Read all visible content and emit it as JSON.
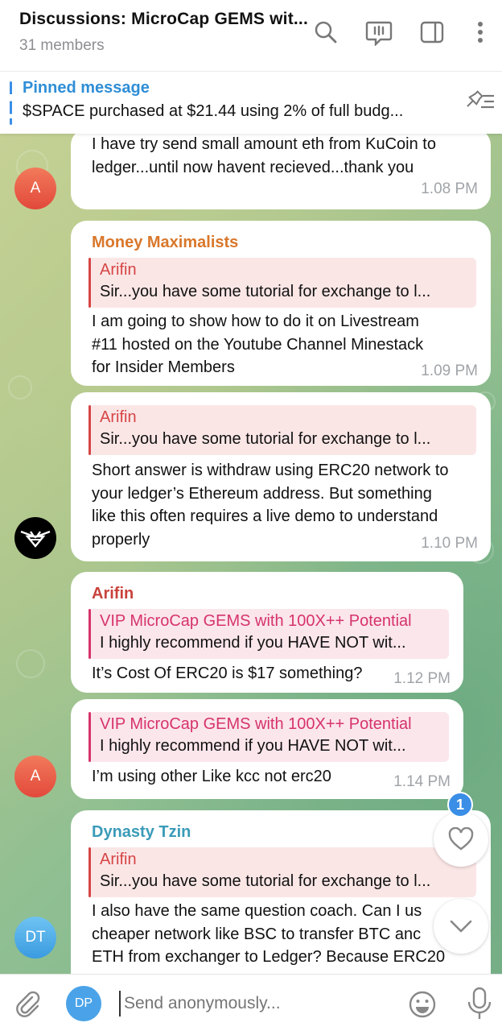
{
  "header": {
    "title": "Discussions: MicroCap GEMS wit...",
    "subtitle": "31 members",
    "icons": [
      "search-icon",
      "live-chat-icon",
      "sidebar-icon",
      "more-vertical-icon"
    ]
  },
  "pinned": {
    "title": "Pinned message",
    "text": "$SPACE purchased at $21.44 using 2% of full budg..."
  },
  "messages": [
    {
      "lines": [
        "I have try send small amount eth from KuCoin to",
        "ledger...until now havent recieved...thank you"
      ],
      "time": "1.08 PM",
      "avatar": "A"
    },
    {
      "sender": "Money Maximalists",
      "reply_name": "Arifin",
      "reply_text": "Sir...you have some tutorial for exchange to l...",
      "lines": [
        "I am going to show how to do it on Livestream",
        "#11 hosted on the Youtube Channel Minestack",
        "for Insider Members"
      ],
      "time": "1.09 PM"
    },
    {
      "reply_name": "Arifin",
      "reply_text": "Sir...you have some tutorial for exchange to l...",
      "lines": [
        "Short answer is withdraw using ERC20 network to",
        "your ledger’s Ethereum address. But something",
        "like this often requires a live demo to understand",
        "properly"
      ],
      "time": "1.10 PM"
    },
    {
      "sender": "Arifin",
      "reply_name": "VIP MicroCap GEMS with 100X++ Potential",
      "reply_text": "I highly recommend if you HAVE NOT wit...",
      "lines": [
        "It’s Cost Of ERC20 is $17 something?"
      ],
      "time": "1.12 PM"
    },
    {
      "reply_name": "VIP MicroCap GEMS with 100X++ Potential",
      "reply_text": "I highly recommend if you HAVE NOT wit...",
      "lines": [
        "I’m using other Like kcc not erc20"
      ],
      "time": "1.14 PM",
      "avatar": "A"
    },
    {
      "sender": "Dynasty Tzin",
      "reply_name": "Arifin",
      "reply_text": "Sir...you have some tutorial for exchange to l...",
      "lines": [
        "I also have the same question coach. Can I us",
        "cheaper network like BSC to transfer BTC anc",
        "ETH from exchanger to Ledger? Because ERC20"
      ],
      "avatar": "DT"
    }
  ],
  "reactions_badge": "1",
  "input": {
    "avatar": "DP",
    "placeholder": "Send anonymously..."
  },
  "colors": {
    "accent": "#3a8ee6",
    "sender_orange": "#d9772b",
    "sender_red": "#c9423b",
    "sender_teal": "#3a9bb8",
    "reply_red": "#d64545",
    "reply_pink": "#d6336c"
  }
}
